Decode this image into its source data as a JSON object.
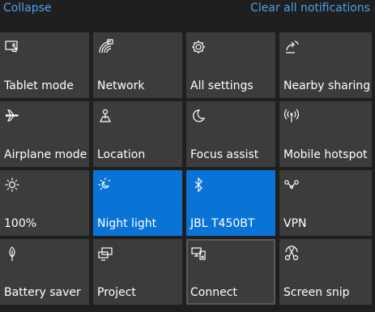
{
  "header": {
    "collapse_label": "Collapse",
    "clear_label": "Clear all notifications"
  },
  "colors": {
    "accent": "#0a74d6",
    "link": "#4da1e8",
    "tile": "#3c3c3c",
    "background": "#1f1f1f"
  },
  "tiles": [
    {
      "label": "Tablet mode",
      "icon": "tablet-mode-icon",
      "active": false
    },
    {
      "label": "Network",
      "icon": "network-icon",
      "active": false
    },
    {
      "label": "All settings",
      "icon": "gear-icon",
      "active": false
    },
    {
      "label": "Nearby sharing",
      "icon": "nearby-sharing-icon",
      "active": false
    },
    {
      "label": "Airplane mode",
      "icon": "airplane-icon",
      "active": false
    },
    {
      "label": "Location",
      "icon": "location-icon",
      "active": false
    },
    {
      "label": "Focus assist",
      "icon": "moon-icon",
      "active": false
    },
    {
      "label": "Mobile hotspot",
      "icon": "hotspot-icon",
      "active": false
    },
    {
      "label": "100%",
      "icon": "brightness-icon",
      "active": false
    },
    {
      "label": "Night light",
      "icon": "night-light-icon",
      "active": true
    },
    {
      "label": "JBL T450BT",
      "icon": "bluetooth-icon",
      "active": true
    },
    {
      "label": "VPN",
      "icon": "vpn-icon",
      "active": false
    },
    {
      "label": "Battery saver",
      "icon": "battery-saver-icon",
      "active": false
    },
    {
      "label": "Project",
      "icon": "project-icon",
      "active": false
    },
    {
      "label": "Connect",
      "icon": "connect-icon",
      "active": false
    },
    {
      "label": "Screen snip",
      "icon": "screen-snip-icon",
      "active": false
    }
  ]
}
